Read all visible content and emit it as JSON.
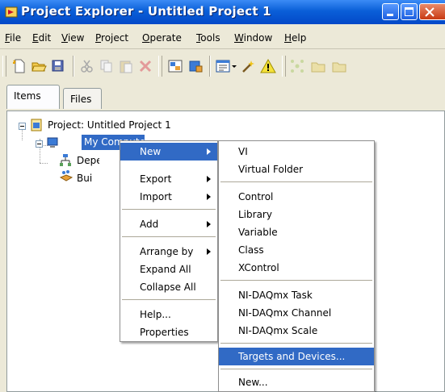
{
  "window": {
    "title": "Project Explorer - Untitled Project 1"
  },
  "menubar": [
    {
      "label": "File",
      "u": "F",
      "rest": "ile"
    },
    {
      "label": "Edit",
      "u": "E",
      "rest": "dit"
    },
    {
      "label": "View",
      "u": "V",
      "rest": "iew"
    },
    {
      "label": "Project",
      "u": "P",
      "rest": "roject"
    },
    {
      "label": "Operate",
      "u": "O",
      "rest": "perate"
    },
    {
      "label": "Tools",
      "u": "T",
      "rest": "ools"
    },
    {
      "label": "Window",
      "u": "W",
      "rest": "indow"
    },
    {
      "label": "Help",
      "u": "H",
      "rest": "elp"
    }
  ],
  "tabs": {
    "items": "Items",
    "files": "Files"
  },
  "tree": {
    "project": "Project: Untitled Project 1",
    "my_computer": "My Computer",
    "dependencies": "Dependencies",
    "build_specs": "Build Specifications"
  },
  "context_menu": {
    "new": "New",
    "export": "Export",
    "import": "Import",
    "add": "Add",
    "arrange_by": "Arrange by",
    "expand_all": "Expand All",
    "collapse_all": "Collapse All",
    "help": "Help...",
    "properties": "Properties"
  },
  "submenu": {
    "vi": "VI",
    "virtual_folder": "Virtual Folder",
    "control": "Control",
    "library": "Library",
    "variable": "Variable",
    "class": "Class",
    "xcontrol": "XControl",
    "daqmx_task": "NI-DAQmx Task",
    "daqmx_channel": "NI-DAQmx Channel",
    "daqmx_scale": "NI-DAQmx Scale",
    "targets_devices": "Targets and Devices...",
    "new_more": "New..."
  },
  "colors": {
    "titlebar": "#0a5fd8",
    "highlight": "#316ac5",
    "window_bg": "#ece9d8"
  }
}
